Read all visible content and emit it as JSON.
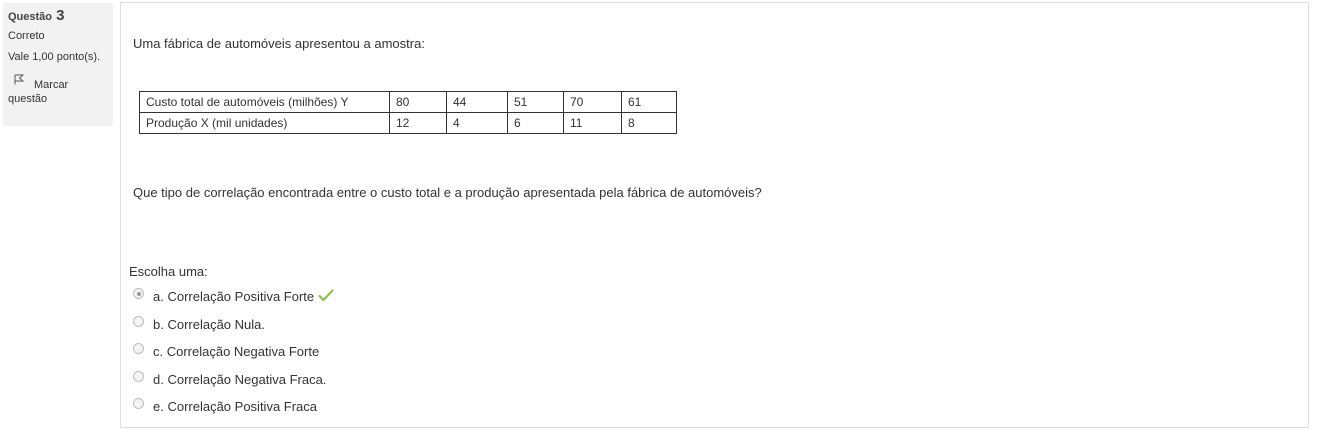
{
  "sidebar": {
    "question_label": "Questão",
    "question_number": "3",
    "state": "Correto",
    "grade": "Vale 1,00 ponto(s).",
    "flag_label_1": "Marcar",
    "flag_label_2": "questão",
    "flag_icon": "flag-icon"
  },
  "question": {
    "intro": "Uma fábrica de automóveis apresentou a amostra:",
    "table": {
      "rows": [
        {
          "label": "Custo total de automóveis (milhões) Y",
          "values": [
            "80",
            "44",
            "51",
            "70",
            "61"
          ]
        },
        {
          "label": "Produção X (mil unidades)",
          "values": [
            "12",
            "4",
            "6",
            "11",
            "8"
          ]
        }
      ]
    },
    "text": "Que tipo de correlação encontrada entre o custo total e a produção apresentada pela fábrica de automóveis?",
    "prompt": "Escolha uma:",
    "answers": [
      {
        "label": "a. Correlação Positiva Forte",
        "selected": true,
        "correct": true
      },
      {
        "label": "b. Correlação Nula.",
        "selected": false
      },
      {
        "label": "c. Correlação Negativa Forte",
        "selected": false
      },
      {
        "label": "d. Correlação Negativa Fraca.",
        "selected": false
      },
      {
        "label": "e. Correlação Positiva Fraca",
        "selected": false
      }
    ],
    "correct_icon": "check-icon",
    "correct_color": "#8bc34a"
  }
}
